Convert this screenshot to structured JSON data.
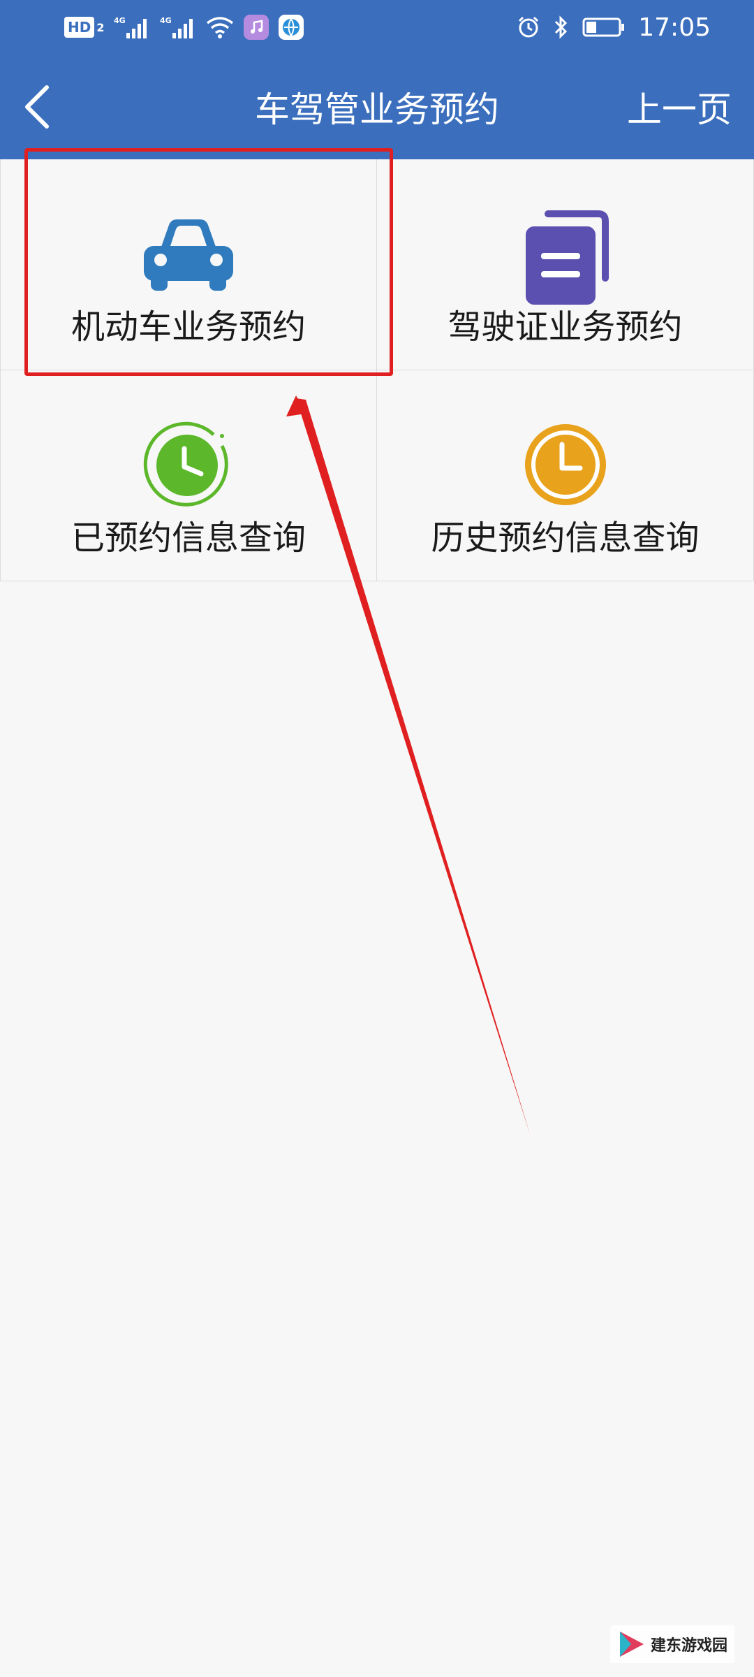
{
  "status_bar": {
    "hd_label": "HD",
    "hd_sub": "2",
    "time": "17:05",
    "icons": [
      "hd-icon",
      "signal-4g-icon",
      "signal-4g-icon",
      "wifi-icon",
      "music-app-icon",
      "browser-app-icon",
      "alarm-icon",
      "bluetooth-icon",
      "battery-icon"
    ]
  },
  "nav": {
    "title": "车驾管业务预约",
    "back_icon": "chevron-left-icon",
    "prev_label": "上一页"
  },
  "tiles": [
    {
      "label": "机动车业务预约",
      "icon": "car-icon",
      "color": "#2f7bbd"
    },
    {
      "label": "驾驶证业务预约",
      "icon": "document-icon",
      "color": "#5b4fb0"
    },
    {
      "label": "已预约信息查询",
      "icon": "clock-icon",
      "color": "#5cb82a"
    },
    {
      "label": "历史预约信息查询",
      "icon": "clock-icon",
      "color": "#e8a21c"
    }
  ],
  "annotation": {
    "highlight_color": "#e02020"
  },
  "watermark": {
    "text": "建东游戏园"
  },
  "colors": {
    "header_bg": "#3b6fbd",
    "page_bg": "#f7f7f7"
  }
}
